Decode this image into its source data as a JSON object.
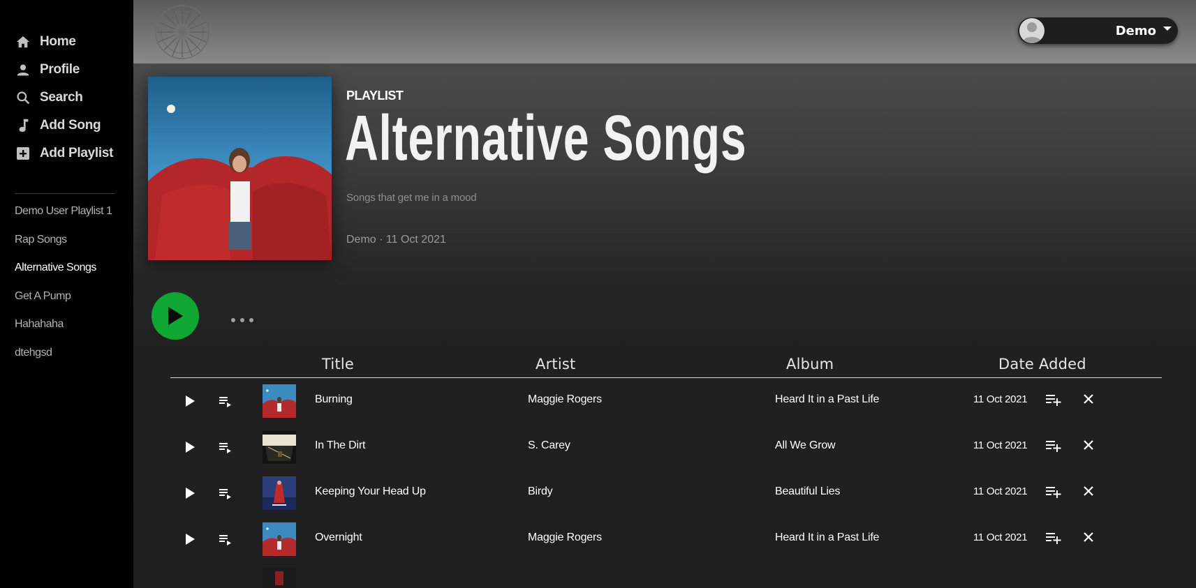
{
  "sidebar": {
    "nav": [
      {
        "label": "Home",
        "icon": "home-icon"
      },
      {
        "label": "Profile",
        "icon": "person-icon"
      },
      {
        "label": "Search",
        "icon": "search-icon"
      },
      {
        "label": "Add Song",
        "icon": "music-note-icon"
      },
      {
        "label": "Add Playlist",
        "icon": "add-box-icon"
      }
    ],
    "playlists": [
      {
        "label": "Demo User Playlist 1"
      },
      {
        "label": "Rap Songs"
      },
      {
        "label": "Alternative Songs",
        "active": true
      },
      {
        "label": "Get A Pump"
      },
      {
        "label": "Hahahaha"
      },
      {
        "label": "dtehgsd"
      }
    ]
  },
  "header": {
    "user_name": "Demo"
  },
  "playlist": {
    "type_label": "PLAYLIST",
    "title": "Alternative Songs",
    "description": "Songs that get me in a mood",
    "meta": "Demo · 11 Oct 2021"
  },
  "table": {
    "headers": {
      "title": "Title",
      "artist": "Artist",
      "album": "Album",
      "date": "Date Added"
    },
    "rows": [
      {
        "title": "Burning",
        "artist": "Maggie Rogers",
        "album": "Heard It in a Past Life",
        "date": "11 Oct 2021",
        "art": "maggie"
      },
      {
        "title": "In The Dirt",
        "artist": "S. Carey",
        "album": "All We Grow",
        "date": "11 Oct 2021",
        "art": "carey"
      },
      {
        "title": "Keeping Your Head Up",
        "artist": "Birdy",
        "album": "Beautiful Lies",
        "date": "11 Oct 2021",
        "art": "birdy"
      },
      {
        "title": "Overnight",
        "artist": "Maggie Rogers",
        "album": "Heard It in a Past Life",
        "date": "11 Oct 2021",
        "art": "maggie"
      }
    ]
  },
  "colors": {
    "accent_green": "#0fa633",
    "sidebar_bg": "#000000",
    "main_bg": "#1f1f1f"
  }
}
